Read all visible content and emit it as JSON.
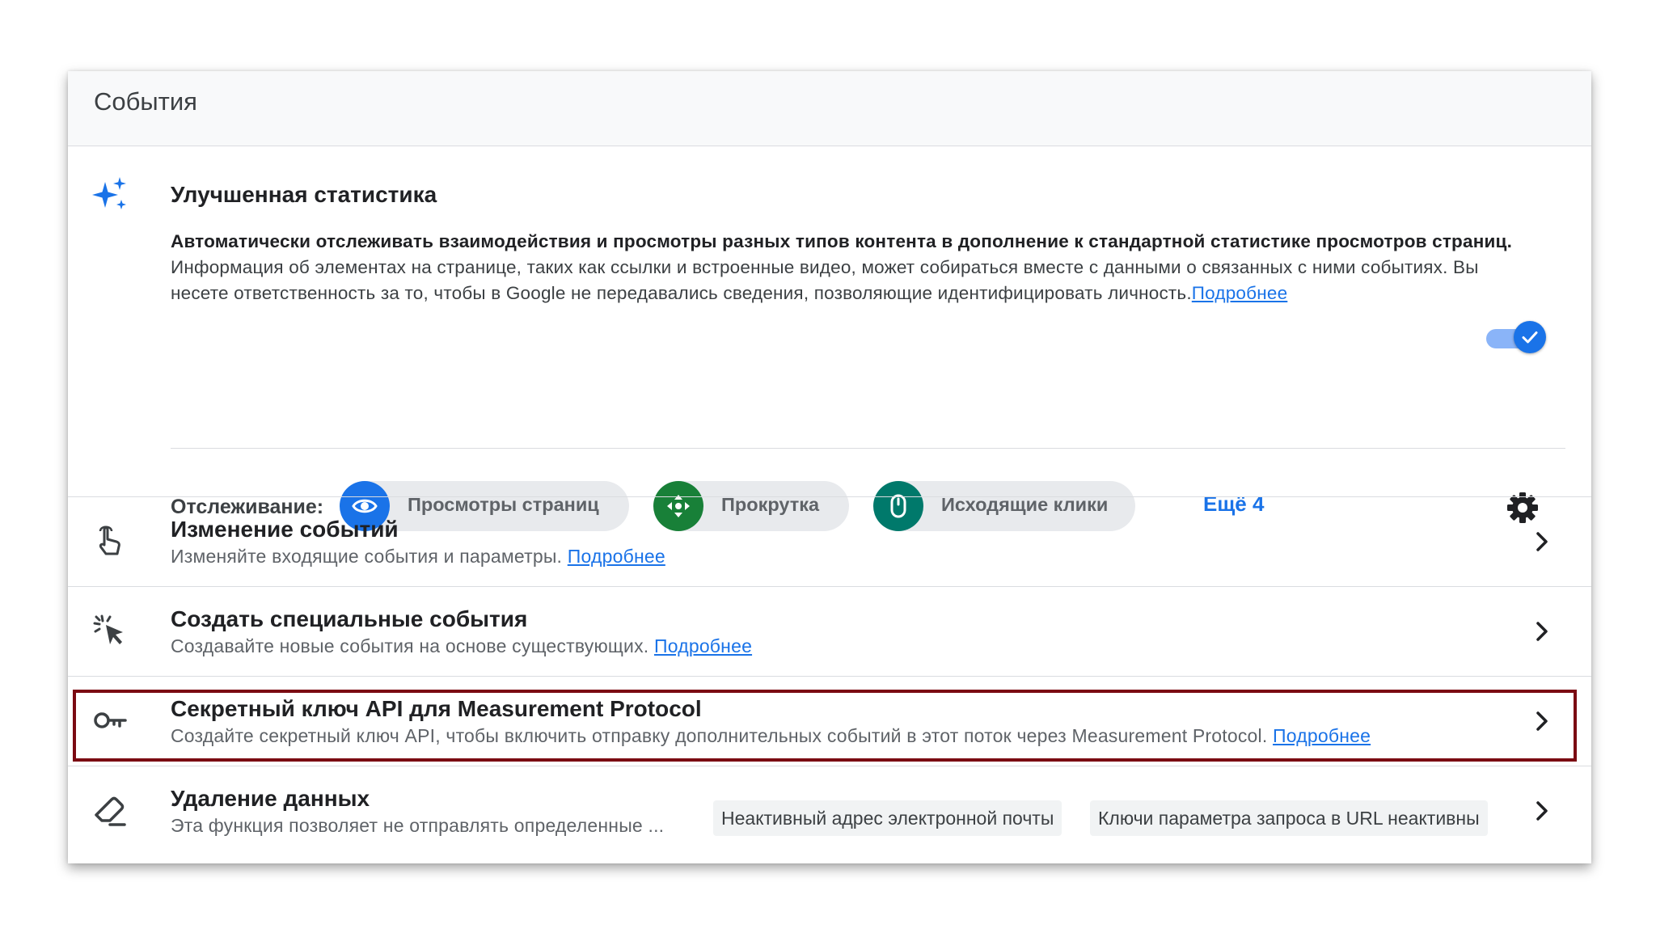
{
  "card": {
    "title": "События"
  },
  "enhanced": {
    "title": "Улучшенная статистика",
    "desc_strong": "Автоматически отслеживать взаимодействия и просмотры разных типов контента в дополнение к стандартной статистике просмотров страниц.",
    "desc_body": "Информация об элементах на странице, таких как ссылки и встроенные видео, может собираться вместе с данными о связанных с ними событиях. Вы несете ответственность за то, чтобы в Google не передавались сведения, позволяющие идентифицировать личность.",
    "learn_more": "Подробнее",
    "toggle_on": true
  },
  "tracking": {
    "label": "Отслеживание:",
    "chips": [
      {
        "label": "Просмотры страниц",
        "icon": "eye-icon",
        "color": "#1a73e8"
      },
      {
        "label": "Прокрутка",
        "icon": "scroll-arrows-icon",
        "color": "#188038"
      },
      {
        "label": "Исходящие клики",
        "icon": "mouse-icon",
        "color": "#00796b"
      }
    ],
    "more": "Ещё 4"
  },
  "rows": [
    {
      "title": "Изменение событий",
      "subtitle": "Изменяйте входящие события и параметры.",
      "link": "Подробнее",
      "icon": "touch-hand-icon"
    },
    {
      "title": "Создать специальные события",
      "subtitle": "Создавайте новые события на основе существующих.",
      "link": "Подробнее",
      "icon": "cursor-click-icon"
    },
    {
      "title": "Секретный ключ API для Measurement Protocol",
      "subtitle": "Создайте секретный ключ API, чтобы включить отправку дополнительных событий в этот поток через Measurement Protocol.",
      "link": "Подробнее",
      "icon": "key-icon"
    },
    {
      "title": "Удаление данных",
      "subtitle": "Эта функция позволяет не отправлять определенные ...",
      "icon": "eraser-icon",
      "tags": [
        "Неактивный адрес электронной почты",
        "Ключи параметра запроса в URL неактивны"
      ]
    }
  ],
  "colors": {
    "accent": "#1a73e8",
    "highlight": "#7b0a12"
  }
}
